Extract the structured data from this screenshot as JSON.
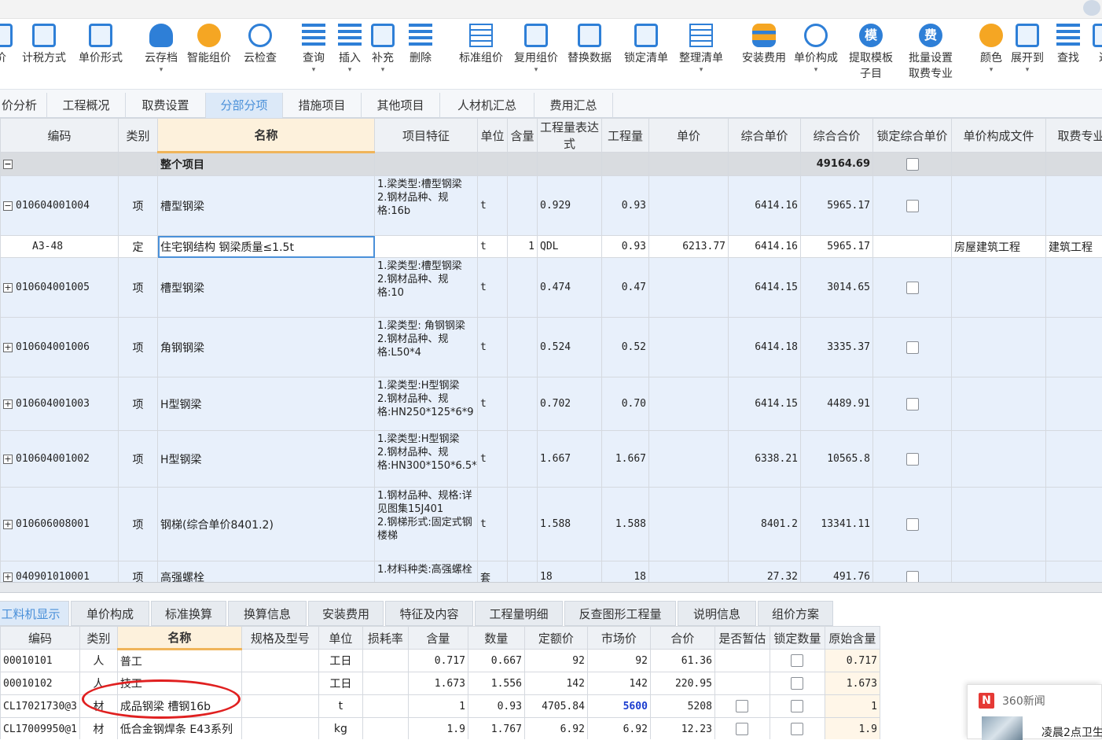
{
  "toolbar": {
    "items": [
      {
        "label": "价",
        "icon": "partial-icon"
      },
      {
        "label": "计税方式",
        "icon": "tax-mode-icon"
      },
      {
        "label": "单价形式",
        "icon": "price-form-icon"
      },
      {
        "label": "云存档",
        "icon": "cloud-save-icon"
      },
      {
        "label": "智能组价",
        "icon": "smart-price-icon"
      },
      {
        "label": "云检查",
        "icon": "cloud-check-icon"
      },
      {
        "label": "查询",
        "icon": "query-icon"
      },
      {
        "label": "插入",
        "icon": "insert-icon"
      },
      {
        "label": "补充",
        "icon": "supplement-icon"
      },
      {
        "label": "删除",
        "icon": "delete-icon"
      },
      {
        "label": "标准组价",
        "icon": "standard-price-icon"
      },
      {
        "label": "复用组价",
        "icon": "reuse-price-icon"
      },
      {
        "label": "替换数据",
        "icon": "replace-data-icon"
      },
      {
        "label": "锁定清单",
        "icon": "lock-icon"
      },
      {
        "label": "整理清单",
        "icon": "organize-list-icon"
      },
      {
        "label": "安装费用",
        "icon": "install-cost-icon"
      },
      {
        "label": "单价构成",
        "icon": "price-composition-icon"
      },
      {
        "label": "提取模板",
        "label2": "子目",
        "icon": "template-icon",
        "glyph": "模"
      },
      {
        "label": "批量设置",
        "label2": "取费专业",
        "icon": "fee-icon",
        "glyph": "费"
      },
      {
        "label": "颜色",
        "icon": "color-icon"
      },
      {
        "label": "展开到",
        "icon": "expand-icon"
      },
      {
        "label": "查找",
        "icon": "find-icon"
      },
      {
        "label": "过",
        "icon": "filter-icon"
      }
    ]
  },
  "tabs": {
    "items": [
      "价分析",
      "工程概况",
      "取费设置",
      "分部分项",
      "措施项目",
      "其他项目",
      "人材机汇总",
      "费用汇总"
    ],
    "active": "分部分项"
  },
  "grid": {
    "headers": [
      "编码",
      "类别",
      "名称",
      "项目特征",
      "单位",
      "含量",
      "工程量表达式",
      "工程量",
      "单价",
      "综合单价",
      "综合合价",
      "锁定综合单价",
      "单价构成文件",
      "取费专业"
    ],
    "total_row": {
      "exp": "−",
      "name": "整个项目",
      "total": "49164.69"
    },
    "rows": [
      {
        "exp": "−",
        "code": "010604001004",
        "cat": "项",
        "name": "槽型钢梁",
        "feature": "1.梁类型:槽型钢梁\n2.钢材品种、规格:16b",
        "unit": "t",
        "content": "",
        "expr": "0.929",
        "qty": "0.93",
        "price": "",
        "unit_total": "6414.16",
        "total": "5965.17",
        "lock": true,
        "file": "",
        "spec": ""
      },
      {
        "exp": "",
        "code": "A3-48",
        "cat": "定",
        "name": "住宅钢结构 钢梁质量≤1.5t",
        "feature": "",
        "unit": "t",
        "content": "1",
        "expr": "QDL",
        "qty": "0.93",
        "price": "6213.77",
        "unit_total": "6414.16",
        "total": "5965.17",
        "lock": false,
        "file": "房屋建筑工程",
        "spec": "建筑工程"
      },
      {
        "exp": "+",
        "code": "010604001005",
        "cat": "项",
        "name": "槽型钢梁",
        "feature": "1.梁类型:槽型钢梁\n2.钢材品种、规格:10",
        "unit": "t",
        "content": "",
        "expr": "0.474",
        "qty": "0.47",
        "price": "",
        "unit_total": "6414.15",
        "total": "3014.65",
        "lock": true,
        "file": "",
        "spec": ""
      },
      {
        "exp": "+",
        "code": "010604001006",
        "cat": "项",
        "name": "角钢钢梁",
        "feature": "1.梁类型: 角钢钢梁\n2.钢材品种、规格:L50*4",
        "unit": "t",
        "content": "",
        "expr": "0.524",
        "qty": "0.52",
        "price": "",
        "unit_total": "6414.18",
        "total": "3335.37",
        "lock": true,
        "file": "",
        "spec": ""
      },
      {
        "exp": "+",
        "code": "010604001003",
        "cat": "项",
        "name": "H型钢梁",
        "feature": "1.梁类型:H型钢梁\n2.钢材品种、规格:HN250*125*6*9",
        "unit": "t",
        "content": "",
        "expr": "0.702",
        "qty": "0.70",
        "price": "",
        "unit_total": "6414.15",
        "total": "4489.91",
        "lock": true,
        "file": "",
        "spec": ""
      },
      {
        "exp": "+",
        "code": "010604001002",
        "cat": "项",
        "name": "H型钢梁",
        "feature": "1.梁类型:H型钢梁\n2.钢材品种、规格:HN300*150*6.5*9",
        "unit": "t",
        "content": "",
        "expr": "1.667",
        "qty": "1.667",
        "price": "",
        "unit_total": "6338.21",
        "total": "10565.8",
        "lock": true,
        "file": "",
        "spec": ""
      },
      {
        "exp": "+",
        "code": "010606008001",
        "cat": "项",
        "name": "钢梯(综合单价8401.2)",
        "feature": "1.钢材品种、规格:详见图集15J401\n2.钢梯形式:固定式钢楼梯",
        "unit": "t",
        "content": "",
        "expr": "1.588",
        "qty": "1.588",
        "price": "",
        "unit_total": "8401.2",
        "total": "13341.11",
        "lock": true,
        "file": "",
        "spec": ""
      },
      {
        "exp": "+",
        "code": "040901010001",
        "cat": "项",
        "name": "高强螺栓",
        "feature": "1.材料种类:高强螺栓",
        "unit": "套",
        "content": "",
        "expr": "18",
        "qty": "18",
        "price": "",
        "unit_total": "27.32",
        "total": "491.76",
        "lock": true,
        "file": "",
        "spec": ""
      }
    ]
  },
  "subtabs": {
    "items": [
      "工料机显示",
      "单价构成",
      "标准换算",
      "换算信息",
      "安装费用",
      "特征及内容",
      "工程量明细",
      "反查图形工程量",
      "说明信息",
      "组价方案"
    ],
    "active": "工料机显示"
  },
  "lower_grid": {
    "headers": [
      "编码",
      "类别",
      "名称",
      "规格及型号",
      "单位",
      "损耗率",
      "含量",
      "数量",
      "定额价",
      "市场价",
      "合价",
      "是否暂估",
      "锁定数量",
      "原始含量"
    ],
    "rows": [
      {
        "code": "00010101",
        "cat": "人",
        "name": "普工",
        "model": "",
        "unit": "工日",
        "loss": "",
        "content": "0.717",
        "qty": "0.667",
        "base": "92",
        "market": "92",
        "total": "61.36",
        "est": "",
        "lockq": true,
        "orig": "0.717"
      },
      {
        "code": "00010102",
        "cat": "人",
        "name": "技工",
        "model": "",
        "unit": "工日",
        "loss": "",
        "content": "1.673",
        "qty": "1.556",
        "base": "142",
        "market": "142",
        "total": "220.95",
        "est": "",
        "lockq": true,
        "orig": "1.673"
      },
      {
        "code": "CL17021730@3",
        "cat": "材",
        "name": "成品钢梁 槽钢16b",
        "model": "",
        "unit": "t",
        "loss": "",
        "content": "1",
        "qty": "0.93",
        "base": "4705.84",
        "market": "5600",
        "total": "5208",
        "est": true,
        "lockq": true,
        "orig": "1"
      },
      {
        "code": "CL17009950@1",
        "cat": "材",
        "name": "低合金钢焊条 E43系列",
        "model": "",
        "unit": "kg",
        "loss": "",
        "content": "1.9",
        "qty": "1.767",
        "base": "6.92",
        "market": "6.92",
        "total": "12.23",
        "est": true,
        "lockq": true,
        "orig": "1.9"
      }
    ],
    "highlight_color": "#1a3ccf"
  },
  "news": {
    "source": "360新闻",
    "headline": "凌晨2点卫生",
    "logo_letter": "N"
  }
}
